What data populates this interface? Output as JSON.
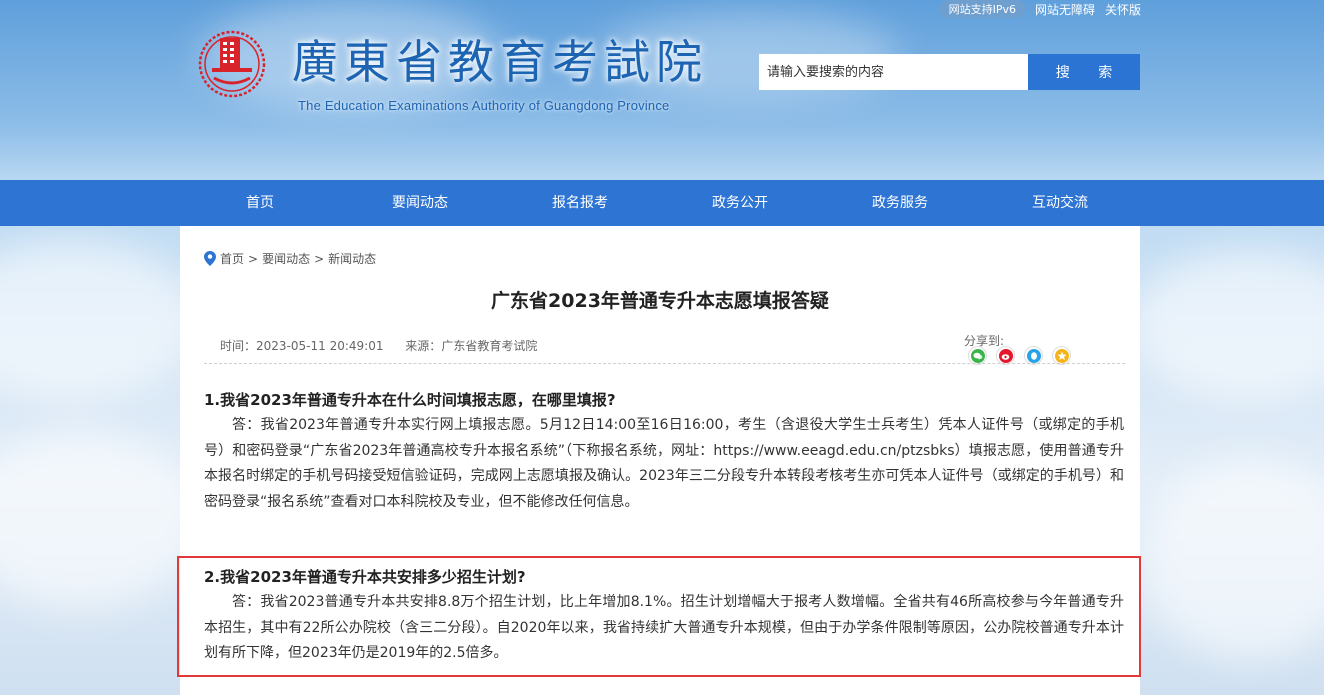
{
  "top_links": {
    "ipv6": "网站支持IPv6",
    "accessibility": "网站无障碍",
    "care": "关怀版"
  },
  "header": {
    "title": "廣東省教育考試院",
    "subtitle": "The Education Examinations Authority of Guangdong Province",
    "brand_color": "#1d64b3"
  },
  "search": {
    "placeholder": "请输入要搜索的内容",
    "button": "搜 索"
  },
  "nav": {
    "items": [
      "首页",
      "要闻动态",
      "报名报考",
      "政务公开",
      "政务服务",
      "互动交流"
    ],
    "color": "#2e74d3"
  },
  "breadcrumb": {
    "home": "首页",
    "level1": "要闻动态",
    "level2": "新闻动态",
    "sep": ">"
  },
  "article": {
    "title": "广东省2023年普通专升本志愿填报答疑",
    "time_label": "时间：",
    "time": "2023-05-11 20:49:01",
    "source_label": "来源：",
    "source": "广东省教育考试院",
    "share_label": "分享到:",
    "share_icons": [
      "wechat-icon",
      "weibo-icon",
      "qq-icon",
      "qzone-icon"
    ],
    "qa": [
      {
        "q": "1.我省2023年普通专升本在什么时间填报志愿，在哪里填报?",
        "a": "答：我省2023年普通专升本实行网上填报志愿。5月12日14:00至16日16:00，考生（含退役大学生士兵考生）凭本人证件号（或绑定的手机号）和密码登录“广东省2023年普通高校专升本报名系统”（下称报名系统，网址：https://www.eeagd.edu.cn/ptzsbks）填报志愿，使用普通专升本报名时绑定的手机号码接受短信验证码，完成网上志愿填报及确认。2023年三二分段专升本转段考核考生亦可凭本人证件号（或绑定的手机号）和密码登录“报名系统”查看对口本科院校及专业，但不能修改任何信息。"
      },
      {
        "q": "2.我省2023年普通专升本共安排多少招生计划?",
        "a": "答：我省2023普通专升本共安排8.8万个招生计划，比上年增加8.1%。招生计划增幅大于报考人数增幅。全省共有46所高校参与今年普通专升本招生，其中有22所公办院校（含三二分段）。自2020年以来，我省持续扩大普通专升本规模，但由于办学条件限制等原因，公办院校普通专升本计划有所下降，但2023年仍是2019年的2.5倍多。"
      }
    ]
  }
}
